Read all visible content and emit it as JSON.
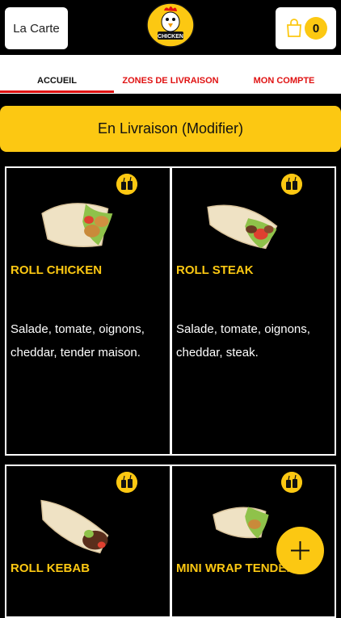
{
  "header": {
    "menu_label": "La Carte",
    "logo_text": "CHICKEN",
    "cart_count": "0"
  },
  "tabs": [
    {
      "label": "ACCUEIL",
      "active": true
    },
    {
      "label": "ZONES DE LIVRAISON",
      "active": false
    },
    {
      "label": "MON COMPTE",
      "active": false
    }
  ],
  "delivery_mode": "En Livraison (Modifier)",
  "products": [
    {
      "name": "ROLL CHICKEN",
      "description": "Salade, tomate, oignons, cheddar, tender maison.",
      "icon": "drink-icon"
    },
    {
      "name": "ROLL STEAK",
      "description": "Salade, tomate, oignons, cheddar, steak.",
      "icon": "drink-icon"
    },
    {
      "name": "ROLL KEBAB",
      "description": "",
      "icon": "drink-icon"
    },
    {
      "name": "MINI WRAP TENDERS",
      "description": "",
      "icon": "drink-icon"
    }
  ],
  "fab_icon": "plus-icon",
  "colors": {
    "accent": "#fcc812",
    "tab_active_underline": "#e01212",
    "tab_link": "#e01212",
    "background": "#000000"
  }
}
